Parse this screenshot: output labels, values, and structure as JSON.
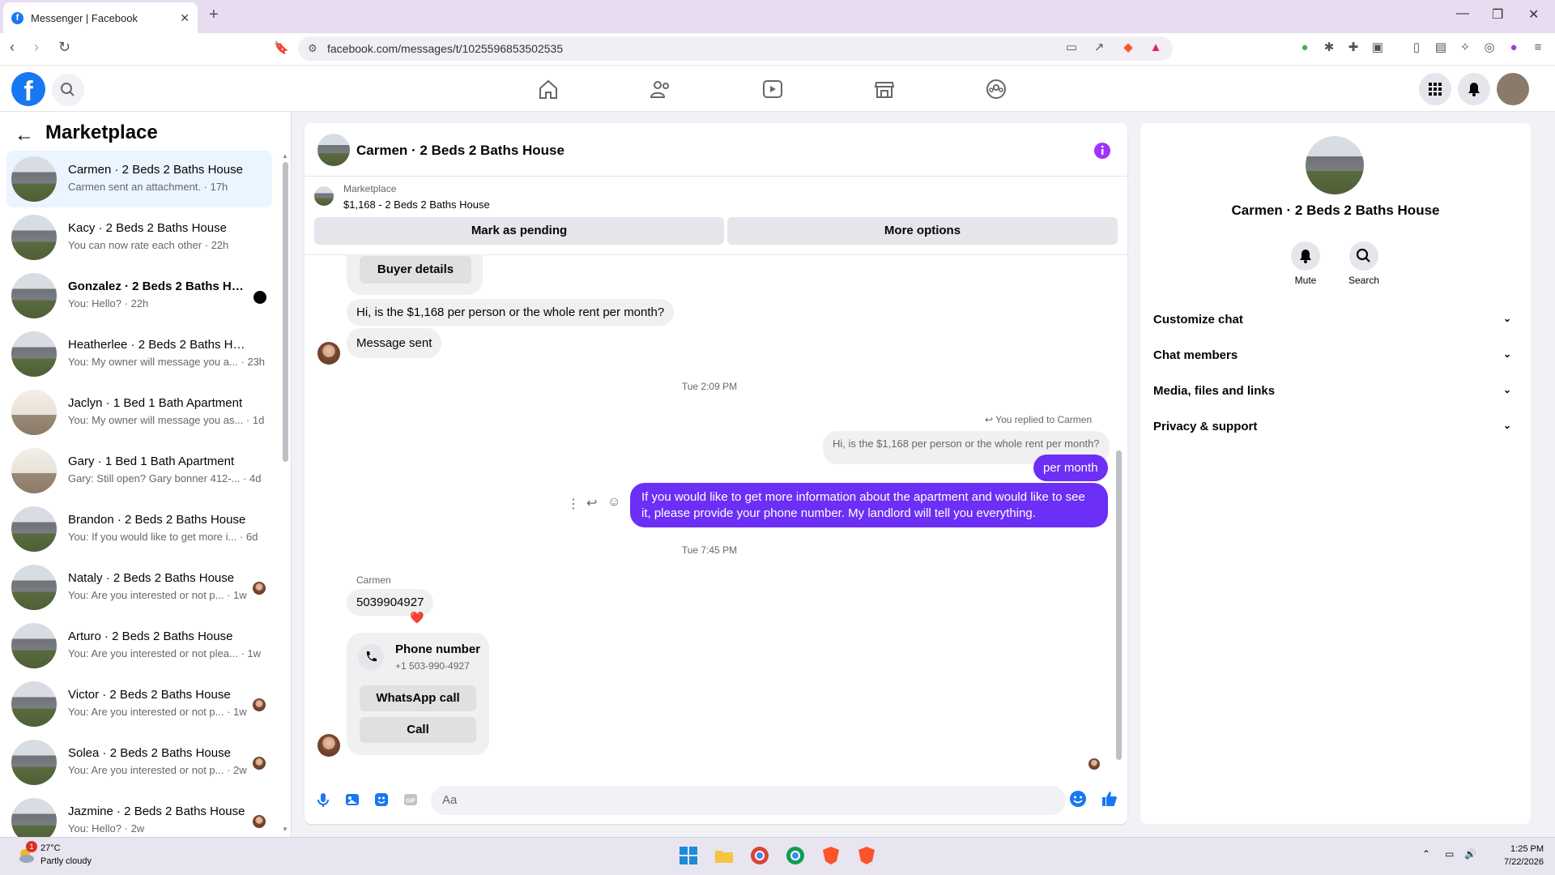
{
  "browser": {
    "tab_title": "Messenger | Facebook",
    "url": "facebook.com/messages/t/1025596853502535"
  },
  "sidebar": {
    "title": "Marketplace",
    "conversations": [
      {
        "name": "Carmen · 2 Beds 2 Baths House",
        "preview": "Carmen sent an attachment. · 17h",
        "selected": true
      },
      {
        "name": "Kacy · 2 Beds 2 Baths House",
        "preview": "You can now rate each other · 22h"
      },
      {
        "name": "Gonzalez · 2 Beds 2 Baths Ho...",
        "preview": "You: Hello? · 22h",
        "unread": true
      },
      {
        "name": "Heatherlee · 2 Beds 2 Baths House",
        "preview": "You: My owner will message you a... · 23h"
      },
      {
        "name": "Jaclyn · 1 Bed 1 Bath Apartment",
        "preview": "You: My owner will message you as... · 1d"
      },
      {
        "name": "Gary · 1 Bed 1 Bath Apartment",
        "preview": "Gary: Still open? Gary bonner 412-... · 4d"
      },
      {
        "name": "Brandon · 2 Beds 2 Baths House",
        "preview": "You: If you would like to get more i... · 6d"
      },
      {
        "name": "Nataly · 2 Beds 2 Baths House",
        "preview": "You: Are you interested or not p... · 1w"
      },
      {
        "name": "Arturo · 2 Beds 2 Baths House",
        "preview": "You: Are you interested or not plea... · 1w"
      },
      {
        "name": "Victor · 2 Beds 2 Baths House",
        "preview": "You: Are you interested or not p... · 1w"
      },
      {
        "name": "Solea · 2 Beds 2 Baths House",
        "preview": "You: Are you interested or not p... · 2w"
      },
      {
        "name": "Jazmine · 2 Beds 2 Baths House",
        "preview": "You: Hello? · 2w"
      }
    ]
  },
  "chat": {
    "title": "Carmen · 2 Beds 2 Baths House",
    "marketplace_label": "Marketplace",
    "listing": "$1,168 - 2 Beds 2 Baths House",
    "mark_pending": "Mark as pending",
    "more_options": "More options",
    "buyer_details": "Buyer details",
    "msg_question": "Hi, is the $1,168 per person or the whole rent per month?",
    "msg_sent": "Message sent",
    "ts1": "Tue 2:09 PM",
    "replied_to": "You replied to Carmen",
    "quoted": "Hi, is the $1,168 per person or the whole rent per month?",
    "msg_per_month": "per month",
    "msg_long_1": "If you would like to get more information about the apartment and would like to see",
    "msg_long_2": "it, please provide your phone number. My landlord will tell you everything.",
    "ts2": "Tue 7:45 PM",
    "sender": "Carmen",
    "msg_phone": "5039904927",
    "reaction": "❤️",
    "phone_card_title": "Phone number",
    "phone_card_number": "+1 503-990-4927",
    "whatsapp_call": "WhatsApp call",
    "call": "Call",
    "composer_placeholder": "Aa"
  },
  "info_panel": {
    "name": "Carmen · 2 Beds 2 Baths House",
    "mute": "Mute",
    "search": "Search",
    "sections": [
      "Customize chat",
      "Chat members",
      "Media, files and links",
      "Privacy & support"
    ]
  },
  "taskbar": {
    "weather_temp": "27°C",
    "weather_desc": "Partly cloudy",
    "weather_badge": "1",
    "time": "1:25 PM",
    "date": "7/22/2026"
  },
  "colors": {
    "accent": "#1877f2",
    "bubble_me": "#6b2ff5",
    "info_icon": "#a033ff"
  }
}
